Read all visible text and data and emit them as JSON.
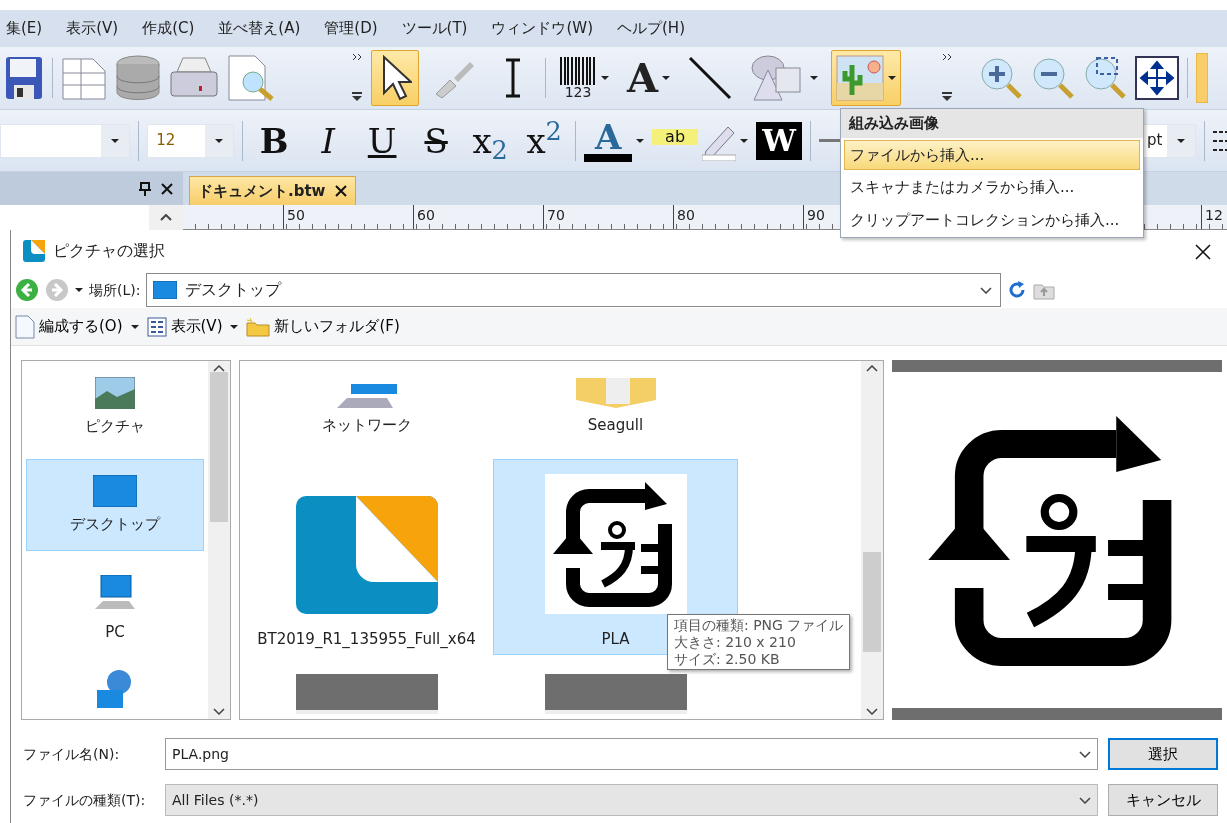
{
  "menu_bar": [
    {
      "label": "集(E)"
    },
    {
      "label": "表示(V)"
    },
    {
      "label": "作成(C)"
    },
    {
      "label": "並べ替え(A)"
    },
    {
      "label": "管理(D)"
    },
    {
      "label": "ツール(T)"
    },
    {
      "label": "ウィンドウ(W)"
    },
    {
      "label": "ヘルプ(H)"
    }
  ],
  "tools": [
    {
      "kind": "pointer",
      "selected": true
    },
    {
      "kind": "brush",
      "selected": false
    },
    {
      "kind": "text-cursor",
      "selected": false
    },
    {
      "kind": "barcode",
      "selected": false,
      "caption": "123"
    },
    {
      "kind": "text",
      "selected": false,
      "glyph": "A"
    },
    {
      "kind": "line",
      "selected": false
    },
    {
      "kind": "shapes",
      "selected": false
    },
    {
      "kind": "picture",
      "selected": true
    }
  ],
  "format_toolbar": {
    "font_size": "12",
    "unit": "pt",
    "buttons": [
      {
        "kind": "bold",
        "glyph": "B"
      },
      {
        "kind": "italic",
        "glyph": "I"
      },
      {
        "kind": "underline",
        "glyph": "U"
      },
      {
        "kind": "strikethrough",
        "glyph": "S"
      },
      {
        "kind": "subscript",
        "glyph": "x$_{2}$"
      },
      {
        "kind": "superscript",
        "glyph": "x$^{2}$"
      },
      {
        "kind": "font-color",
        "glyph": "A"
      },
      {
        "kind": "highlight",
        "glyph": "ab"
      },
      {
        "kind": "inverse",
        "glyph": "W"
      }
    ]
  },
  "image_menu": {
    "header": "組み込み画像",
    "items": [
      {
        "label": "ファイルから挿入...",
        "selected": true
      },
      {
        "label": "スキャナまたはカメラから挿入...",
        "selected": false
      },
      {
        "label": "クリップアートコレクションから挿入...",
        "selected": false
      }
    ]
  },
  "document_tabs": [
    {
      "label": "ドキュメント.btw",
      "selected": true
    }
  ],
  "ruler": [
    "50",
    "60",
    "70",
    "80",
    "90",
    "12"
  ],
  "dialog": {
    "title": "ピクチャの選択",
    "location_label": "場所(L):",
    "location": "デスクトップ",
    "commands": [
      {
        "kind": "organize",
        "label": "編成する(O)"
      },
      {
        "kind": "view",
        "label": "表示(V)"
      },
      {
        "kind": "new-folder",
        "label": "新しいフォルダ(F)"
      }
    ],
    "nav_items": [
      {
        "kind": "pictures",
        "label": "ピクチャ",
        "selected": false
      },
      {
        "kind": "desktop",
        "label": "デスクトップ",
        "selected": true
      },
      {
        "kind": "pc",
        "label": "PC",
        "selected": false
      },
      {
        "kind": "network",
        "selected": false
      }
    ],
    "files": [
      {
        "kind": "network",
        "name": "ネットワーク",
        "selected": false
      },
      {
        "kind": "folder",
        "name": "Seagull",
        "selected": false
      },
      {
        "kind": "app",
        "name": "BT2019_R1_135955_Full_x64",
        "selected": false
      },
      {
        "kind": "pla",
        "name": "PLA",
        "selected": true
      },
      {
        "kind": "label-doc",
        "selected": false
      },
      {
        "kind": "label-doc",
        "selected": false
      }
    ],
    "tooltip": [
      "項目の種類: PNG ファイル",
      "大きさ: 210 x 210",
      "サイズ: 2.50 KB"
    ],
    "file_name_label": "ファイル名(N):",
    "file_name": "PLA.png",
    "file_type_label": "ファイルの種類(T):",
    "file_type": "All Files (*.*)",
    "buttons": [
      {
        "kind": "primary",
        "label": "選択"
      },
      {
        "kind": "cancel",
        "label": "キャンセル"
      }
    ]
  }
}
